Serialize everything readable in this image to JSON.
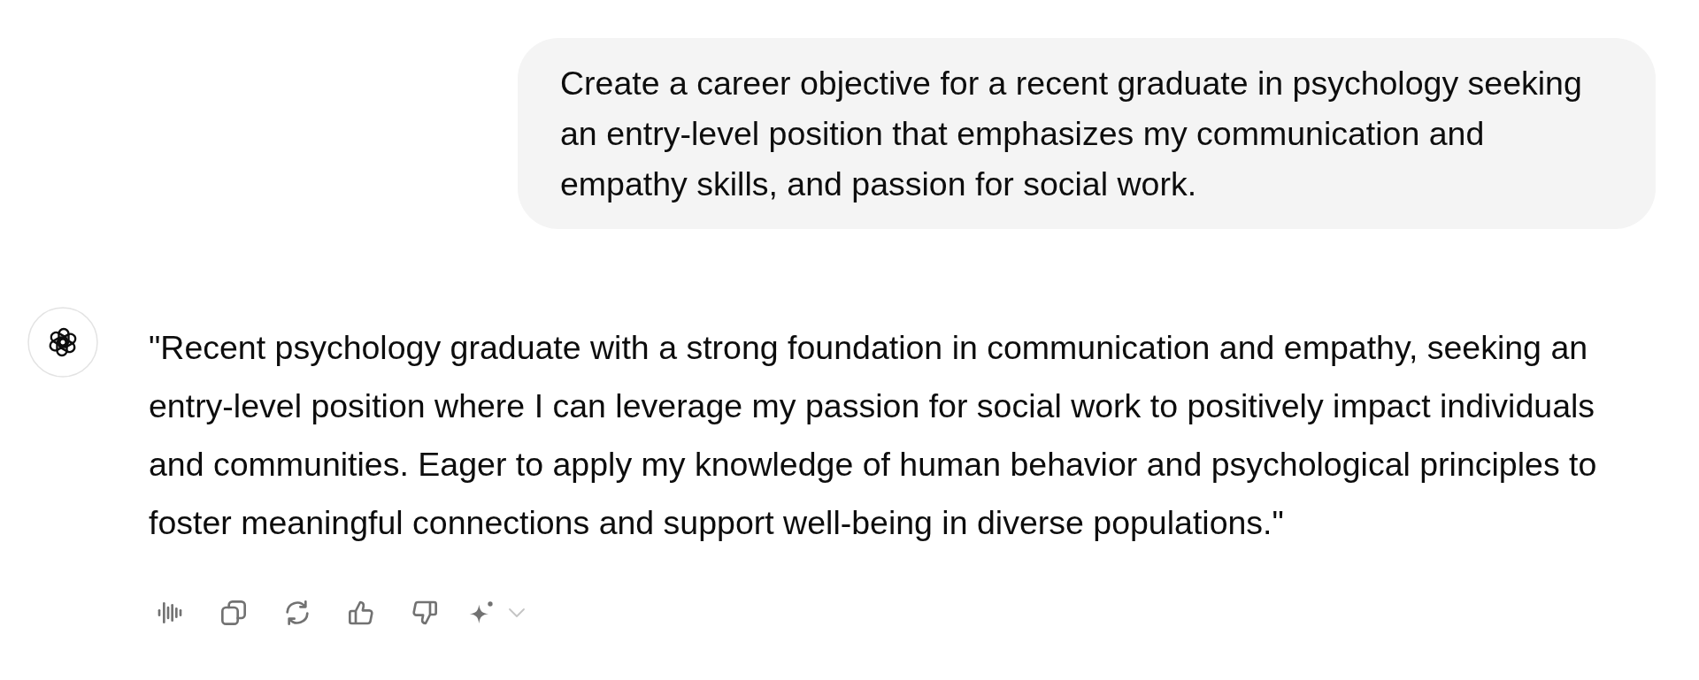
{
  "user_message": {
    "text": "Create a career objective for a recent graduate in psychology seeking an entry-level position that emphasizes my communication and empathy skills, and passion for social work."
  },
  "assistant_message": {
    "text": "\"Recent psychology graduate with a strong foundation in communication and empathy, seeking an entry-level position where I can leverage my passion for social work to positively impact individuals and communities. Eager to apply my knowledge of human behavior and psychological principles to foster meaningful connections and support well-being in diverse populations.\""
  }
}
